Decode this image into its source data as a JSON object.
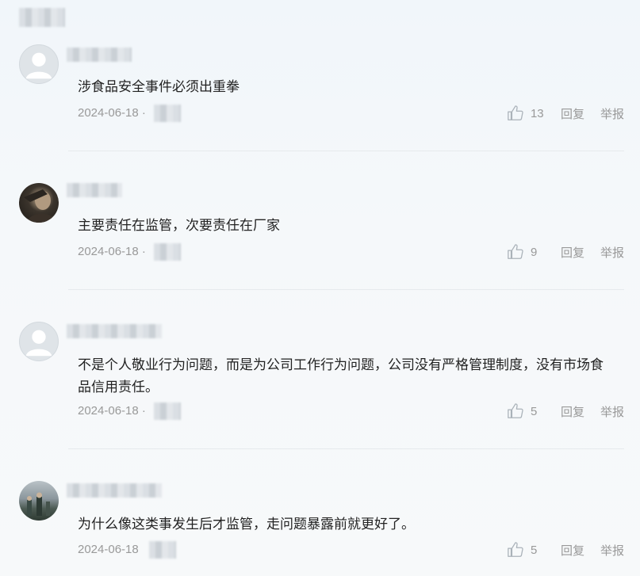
{
  "comments": [
    {
      "text": "涉食品安全事件必须出重拳",
      "date": "2024-06-18 ·",
      "likes": "13",
      "reply_label": "回复",
      "report_label": "举报",
      "avatar": "default-avatar"
    },
    {
      "text": "主要责任在监管，次要责任在厂家",
      "date": "2024-06-18 ·",
      "likes": "9",
      "reply_label": "回复",
      "report_label": "举报",
      "avatar": "photo-avatar"
    },
    {
      "text": "不是个人敬业行为问题，而是为公司工作行为问题，公司没有严格管理制度，没有市场食品信用责任。",
      "date": "2024-06-18 ·",
      "likes": "5",
      "reply_label": "回复",
      "report_label": "举报",
      "avatar": "default-avatar"
    },
    {
      "text": "为什么像这类事发生后才监管，走问题暴露前就更好了。",
      "date": "2024-06-18",
      "likes": "5",
      "reply_label": "回复",
      "report_label": "举报",
      "avatar": "photo-avatar"
    }
  ],
  "icons": {
    "like": "thumbs-up-icon"
  },
  "colors": {
    "meta": "#999999",
    "text": "#222222",
    "background": "#f5f8fa"
  }
}
